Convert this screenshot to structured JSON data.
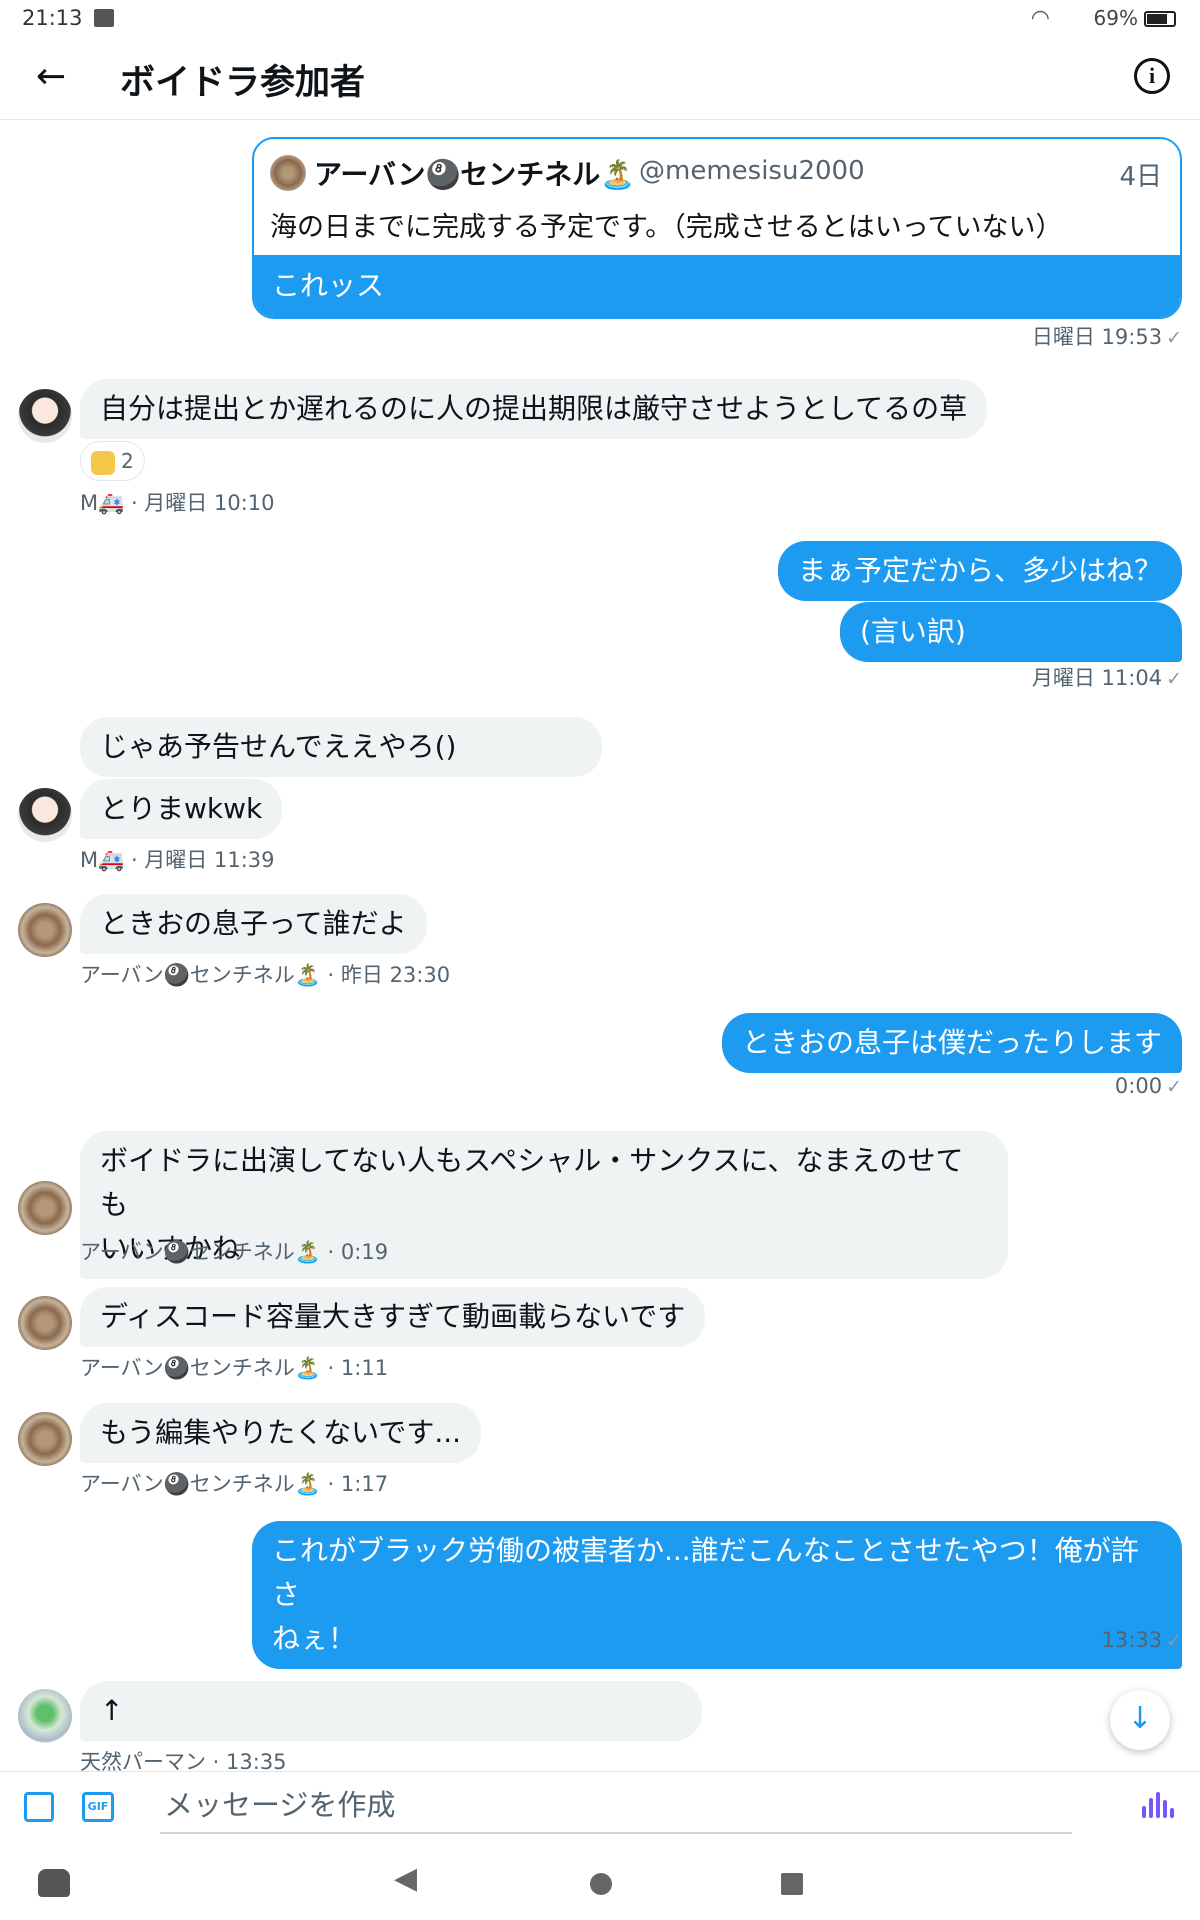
{
  "status_bar": {
    "time": "21:13",
    "battery": "69%"
  },
  "header": {
    "title": "ボイドラ参加者"
  },
  "quote": {
    "name": "アーバン🎱センチネル🏝️",
    "handle": "@memesisu2000",
    "date": "4日",
    "text": "海の日までに完成する予定です。（完成させるとはいっていない）",
    "comment": "これッス",
    "meta": "日曜日 19:53"
  },
  "messages": [
    {
      "id": "m1",
      "text": "自分は提出とか遅れるのに人の提出期限は厳守させようとしてるの草"
    },
    {
      "id": "m2",
      "text": "まぁ予定だから、多少はね？"
    },
    {
      "id": "m3",
      "text": "(言い訳)"
    },
    {
      "id": "m4",
      "text": "じゃあ予告せんでええやろ()"
    },
    {
      "id": "m5",
      "text": "とりまwkwk"
    },
    {
      "id": "m6",
      "text": "ときおの息子って誰だよ"
    },
    {
      "id": "m7",
      "text": "ときおの息子は僕だったりします"
    },
    {
      "id": "m8a",
      "text": "ボイドラに出演してない人もスペシャル・サンクスに、なまえのせても"
    },
    {
      "id": "m8b",
      "text": "いいすかね"
    },
    {
      "id": "m9",
      "text": "ディスコード容量大きすぎて動画載らないです"
    },
    {
      "id": "m10",
      "text": "もう編集やりたくないです..."
    },
    {
      "id": "m11a",
      "text": "これがブラック労働の被害者か...誰だこんなことさせたやつ！俺が許さ"
    },
    {
      "id": "m11b",
      "text": "ねぇ！"
    },
    {
      "id": "m12",
      "text": "↑"
    }
  ],
  "reaction": {
    "count": "2"
  },
  "meta": {
    "m1": "M🚑 · 月曜日 10:10",
    "m3": "月曜日 11:04",
    "m5": "M🚑 · 月曜日 11:39",
    "m6": "アーバン🎱センチネル🏝️ · 昨日 23:30",
    "m7": "0:00",
    "m8": "アーバン🎱センチネル🏝️ · 0:19",
    "m9": "アーバン🎱センチネル🏝️ · 1:11",
    "m10": "アーバン🎱センチネル🏝️ · 1:17",
    "m11": "13:33",
    "m12": "天然パーマン · 13:35"
  },
  "check_mark": "✓",
  "composer": {
    "placeholder": "メッセージを作成",
    "gif_label": "GIF"
  },
  "icons": {
    "back": "←",
    "info": "i",
    "scroll_down": "↓",
    "nav_back": "◀"
  },
  "colors": {
    "accent": "#1d9bf0",
    "incoming_bubble": "#eff3f4",
    "voice": "#7856ff"
  }
}
